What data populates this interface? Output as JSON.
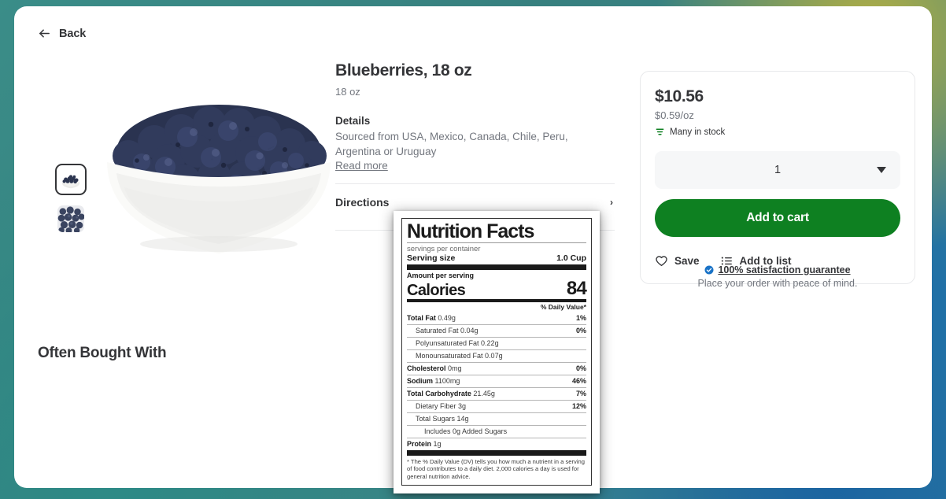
{
  "nav": {
    "back_label": "Back",
    "back_icon": "arrow-left-icon"
  },
  "gallery": {
    "thumbnails": [
      {
        "alt": "Bowl of blueberries",
        "selected": true
      },
      {
        "alt": "Close-up of blueberries",
        "selected": false
      }
    ],
    "hero_alt": "White bowl filled with fresh blueberries"
  },
  "often_bought_with": {
    "heading": "Often Bought With"
  },
  "product": {
    "title": "Blueberries, 18 oz",
    "size": "18 oz",
    "details_heading": "Details",
    "details_text": "Sourced from USA, Mexico, Canada, Chile, Peru, Argentina or Uruguay",
    "read_more": "Read more",
    "directions_label": "Directions",
    "directions_chevron": "chevron-right-icon"
  },
  "nutrition": {
    "title": "Nutrition Facts",
    "servings_per_container": "servings per container",
    "serving_size_label": "Serving size",
    "serving_size_value": "1.0 Cup",
    "amount_per_serving": "Amount per serving",
    "calories_label": "Calories",
    "calories_value": "84",
    "daily_value_header": "% Daily Value*",
    "rows": [
      {
        "name": "Total Fat",
        "amount": "0.49g",
        "pct": "1%",
        "indent": 0,
        "bold": true
      },
      {
        "name": "Saturated Fat",
        "amount": "0.04g",
        "pct": "0%",
        "indent": 1,
        "bold": false
      },
      {
        "name": "Polyunsaturated Fat",
        "amount": "0.22g",
        "pct": "",
        "indent": 1,
        "bold": false
      },
      {
        "name": "Monounsaturated Fat",
        "amount": "0.07g",
        "pct": "",
        "indent": 1,
        "bold": false
      },
      {
        "name": "Cholesterol",
        "amount": "0mg",
        "pct": "0%",
        "indent": 0,
        "bold": true
      },
      {
        "name": "Sodium",
        "amount": "1100mg",
        "pct": "46%",
        "indent": 0,
        "bold": true
      },
      {
        "name": "Total Carbohydrate",
        "amount": "21.45g",
        "pct": "7%",
        "indent": 0,
        "bold": true
      },
      {
        "name": "Dietary Fiber",
        "amount": "3g",
        "pct": "12%",
        "indent": 1,
        "bold": false
      },
      {
        "name": "Total Sugars",
        "amount": "14g",
        "pct": "",
        "indent": 1,
        "bold": false
      },
      {
        "name": "Includes 0g Added Sugars",
        "amount": "",
        "pct": "",
        "indent": 2,
        "bold": false
      },
      {
        "name": "Protein",
        "amount": "1g",
        "pct": "",
        "indent": 0,
        "bold": true
      }
    ],
    "footnote": "* The % Daily Value (DV) tells you how much a nutrient in a serving of food contributes to a daily diet. 2,000 calories a day is used for general nutrition advice."
  },
  "buybox": {
    "price": "$10.56",
    "unit_price": "$0.59/oz",
    "stock_text": "Many in stock",
    "stock_icon": "stock-level-icon",
    "stock_color": "#0e8021",
    "quantity_value": "1",
    "quantity_caret_icon": "chevron-down-icon",
    "add_to_cart_label": "Add to cart",
    "add_to_cart_color": "#0e8021",
    "save_label": "Save",
    "save_icon": "heart-icon",
    "add_to_list_label": "Add to list",
    "add_to_list_icon": "list-icon"
  },
  "guarantee": {
    "badge_icon": "verified-check-icon",
    "headline": "100% satisfaction guarantee",
    "subtext": "Place your order with peace of mind."
  }
}
